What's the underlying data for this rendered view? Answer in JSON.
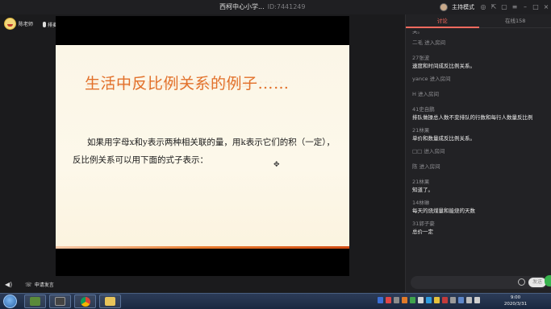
{
  "window": {
    "title": "西柯中心小学...",
    "room_id": "ID:7441249",
    "user_mode": "主持模式"
  },
  "top_bar": {
    "teacher_name": "陈老师",
    "queue_label": "排麦"
  },
  "slide": {
    "title": "生活中反比例关系的例子……",
    "body": "如果用字母x和y表示两种相关联的量，用k表示它们的积（一定），反比例关系可以用下面的式子表示："
  },
  "controls": {
    "apply_voice": "申请发言"
  },
  "panel": {
    "tabs": [
      {
        "label": "讨论",
        "active": true
      },
      {
        "label": "在线158",
        "active": false
      }
    ],
    "messages": [
      {
        "type": "join",
        "text": "二毛 进入房间"
      },
      {
        "type": "chat",
        "user": "27张波",
        "text": "速度和时间成反比例关系。"
      },
      {
        "type": "join",
        "text": "yance 进入房间"
      },
      {
        "type": "join",
        "text": "H 进入房间"
      },
      {
        "type": "chat",
        "user": "41史自鹏",
        "text": "排队做操总人数不变排队的行数和每行人数量反比例"
      },
      {
        "type": "chat",
        "user": "21林果",
        "text": "单价和数量成反比例关系。"
      },
      {
        "type": "join",
        "text": "□□ 进入房间"
      },
      {
        "type": "join",
        "text": "陈 进入房间"
      },
      {
        "type": "chat",
        "user": "21林果",
        "text": "知道了。"
      },
      {
        "type": "chat",
        "user": "14林琳",
        "text": "每天的烧煤量和能烧的天数"
      },
      {
        "type": "chat",
        "user": "31郭子豪",
        "text": "总价一定"
      }
    ],
    "send_label": "发送"
  },
  "taskbar": {
    "time": "9:00",
    "date": "2020/3/31"
  },
  "colors": {
    "accent": "#ff6b5f",
    "slide_title": "#e2702a",
    "panel_bg": "#222225"
  }
}
